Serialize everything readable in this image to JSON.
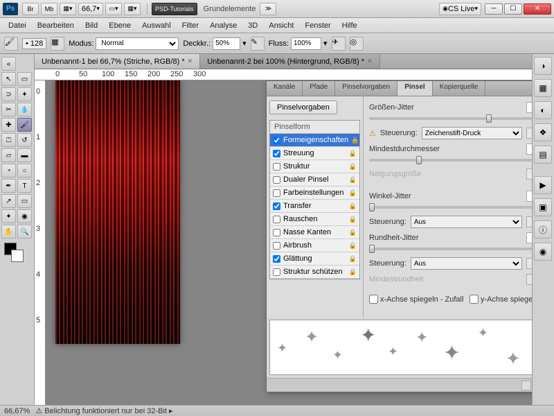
{
  "titlebar": {
    "br": "Br",
    "mb": "Mb",
    "zoom": "66,7",
    "psd_tut": "PSD-Tutorials",
    "doc_name": "Grundelemente",
    "cslive": "CS Live"
  },
  "menu": [
    "Datei",
    "Bearbeiten",
    "Bild",
    "Ebene",
    "Auswahl",
    "Filter",
    "Analyse",
    "3D",
    "Ansicht",
    "Fenster",
    "Hilfe"
  ],
  "optbar": {
    "size": "128",
    "modus_label": "Modus:",
    "modus_value": "Normal",
    "deck_label": "Deckkr.:",
    "deck_value": "50%",
    "fluss_label": "Fluss:",
    "fluss_value": "100%"
  },
  "tabs": {
    "t1": "Unbenannt-1 bei 66,7% (Striche, RGB/8) *",
    "t2": "Unbenannt-2 bei 100% (Hintergrund, RGB/8) *"
  },
  "ruler_h": [
    "0",
    "50",
    "100",
    "150",
    "200",
    "250",
    "300"
  ],
  "ruler_v": [
    "0",
    "1",
    "2",
    "3",
    "4",
    "5"
  ],
  "panel": {
    "tabs": [
      "Kanäle",
      "Pfade",
      "Pinselvorgaben",
      "Pinsel",
      "Kopierquelle"
    ],
    "preset_btn": "Pinselvorgaben",
    "opt_header": "Pinselform",
    "opts": [
      {
        "label": "Formeigenschaften",
        "checked": true,
        "sel": true
      },
      {
        "label": "Streuung",
        "checked": true
      },
      {
        "label": "Struktur",
        "checked": false
      },
      {
        "label": "Dualer Pinsel",
        "checked": false
      },
      {
        "label": "Farbeinstellungen",
        "checked": false
      },
      {
        "label": "Transfer",
        "checked": true
      },
      {
        "label": "Rauschen",
        "checked": false
      },
      {
        "label": "Nasse Kanten",
        "checked": false
      },
      {
        "label": "Airbrush",
        "checked": false
      },
      {
        "label": "Glättung",
        "checked": true
      },
      {
        "label": "Struktur schützen",
        "checked": false
      }
    ],
    "right": {
      "groessen_jitter": "Größen-Jitter",
      "groessen_val": "62%",
      "steuerung": "Steuerung:",
      "steuer1": "Zeichenstift-Druck",
      "mindest": "Mindestdurchmesser",
      "mindest_val": "25%",
      "neigung": "Neigungsgröße",
      "winkel": "Winkel-Jitter",
      "winkel_val": "0%",
      "steuer2": "Aus",
      "rundheit": "Rundheit-Jitter",
      "rundheit_val": "0%",
      "steuer3": "Aus",
      "mindestrund": "Mindestrundheit",
      "xflip": "x-Achse spiegeln - Zufall",
      "yflip": "y-Achse spiegeln - Zufall"
    }
  },
  "status": {
    "zoom": "66,67%",
    "msg": "Belichtung funktioniert nur bei 32-Bit"
  }
}
